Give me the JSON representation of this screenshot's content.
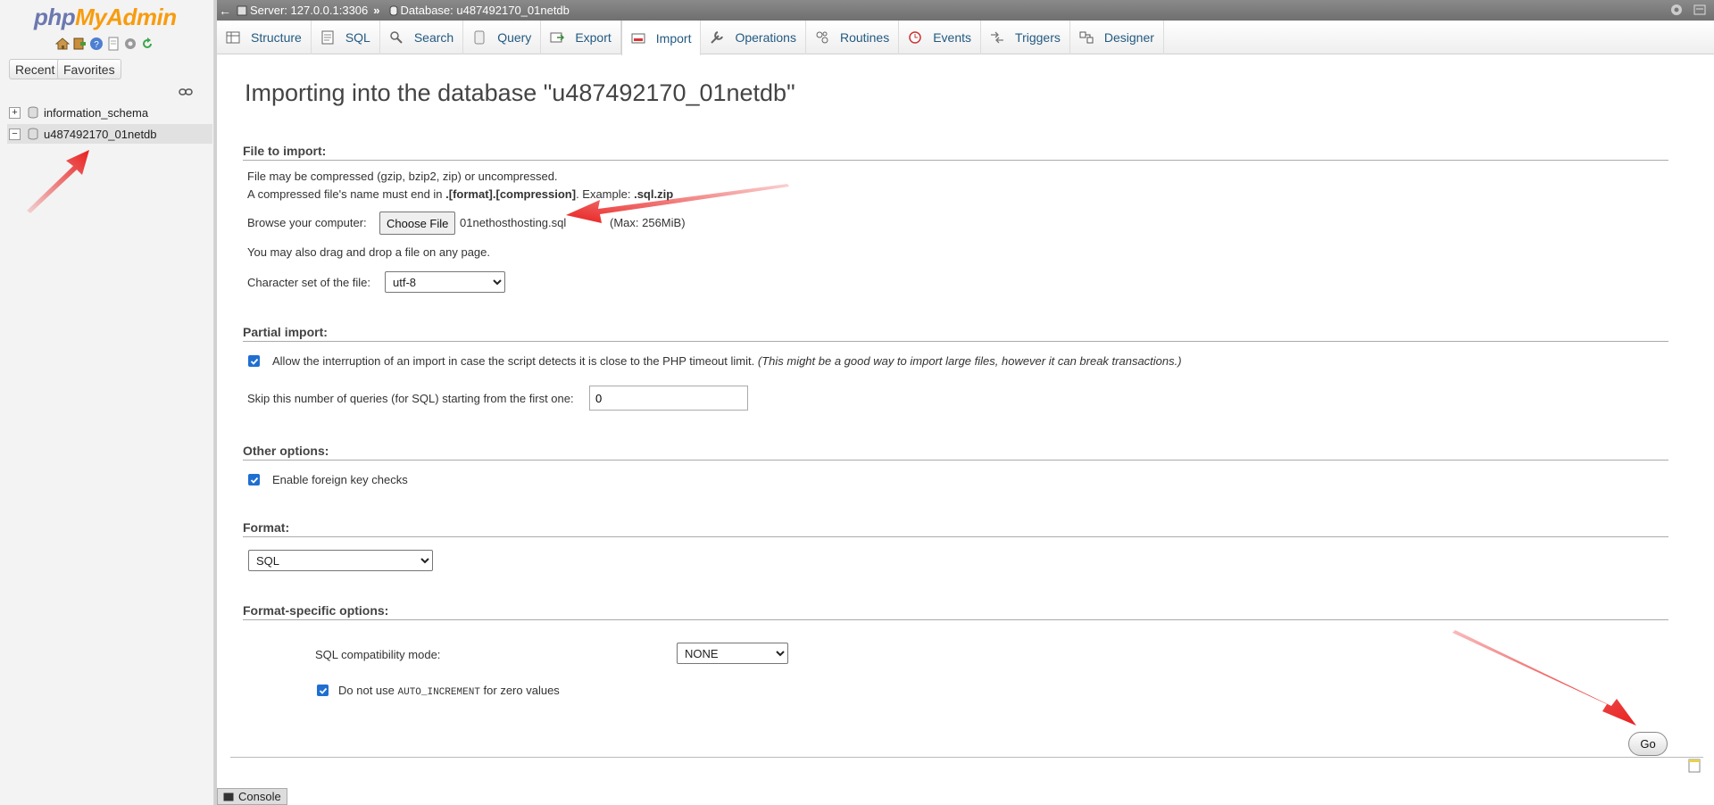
{
  "sidebar": {
    "logo_php": "php",
    "logo_rest": "MyAdmin",
    "recent_label": "Recent",
    "favorites_label": "Favorites",
    "databases": [
      {
        "name": "information_schema",
        "expander": "+"
      },
      {
        "name": "u487492170_01netdb",
        "expander": "−"
      }
    ]
  },
  "topbar": {
    "server": "Server: 127.0.0.1:3306",
    "separator": "»",
    "database": "Database: u487492170_01netdb"
  },
  "tabs": [
    {
      "label": "Structure",
      "icon": "structure-icon"
    },
    {
      "label": "SQL",
      "icon": "sql-icon"
    },
    {
      "label": "Search",
      "icon": "search-icon"
    },
    {
      "label": "Query",
      "icon": "query-icon"
    },
    {
      "label": "Export",
      "icon": "export-icon"
    },
    {
      "label": "Import",
      "icon": "import-icon",
      "active": true
    },
    {
      "label": "Operations",
      "icon": "operations-icon"
    },
    {
      "label": "Routines",
      "icon": "routines-icon"
    },
    {
      "label": "Events",
      "icon": "events-icon"
    },
    {
      "label": "Triggers",
      "icon": "triggers-icon"
    },
    {
      "label": "Designer",
      "icon": "designer-icon"
    }
  ],
  "main": {
    "title": "Importing into the database \"u487492170_01netdb\"",
    "file_section": {
      "heading": "File to import:",
      "line1": "File may be compressed (gzip, bzip2, zip) or uncompressed.",
      "line2_a": "A compressed file's name must end in ",
      "line2_b": ".[format].[compression]",
      "line2_c": ". Example: ",
      "line2_d": ".sql.zip",
      "browse_label": "Browse your computer:",
      "choose_file": "Choose File",
      "file_name": "01nethosthosting.sql",
      "max_size": "(Max: 256MiB)",
      "drag_drop": "You may also drag and drop a file on any page.",
      "charset_label": "Character set of the file:",
      "charset_value": "utf-8"
    },
    "partial_section": {
      "heading": "Partial import:",
      "allow_interrupt": "Allow the interruption of an import in case the script detects it is close to the PHP timeout limit.",
      "allow_interrupt_note": "(This might be a good way to import large files, however it can break transactions.)",
      "allow_interrupt_checked": true,
      "skip_label": "Skip this number of queries (for SQL) starting from the first one:",
      "skip_value": "0"
    },
    "other_section": {
      "heading": "Other options:",
      "fk_checks": "Enable foreign key checks",
      "fk_checks_checked": true
    },
    "format_section": {
      "heading": "Format:",
      "format_value": "SQL"
    },
    "format_specific": {
      "heading": "Format-specific options:",
      "compat_label": "SQL compatibility mode:",
      "compat_value": "NONE",
      "auto_inc_a": "Do not use ",
      "auto_inc_code": "AUTO_INCREMENT",
      "auto_inc_b": " for zero values",
      "auto_inc_checked": true
    },
    "go_label": "Go"
  },
  "console_label": "Console",
  "colors": {
    "link": "#235a81",
    "checkbox": "#1f6fd0",
    "arrow": "#e8201f"
  }
}
